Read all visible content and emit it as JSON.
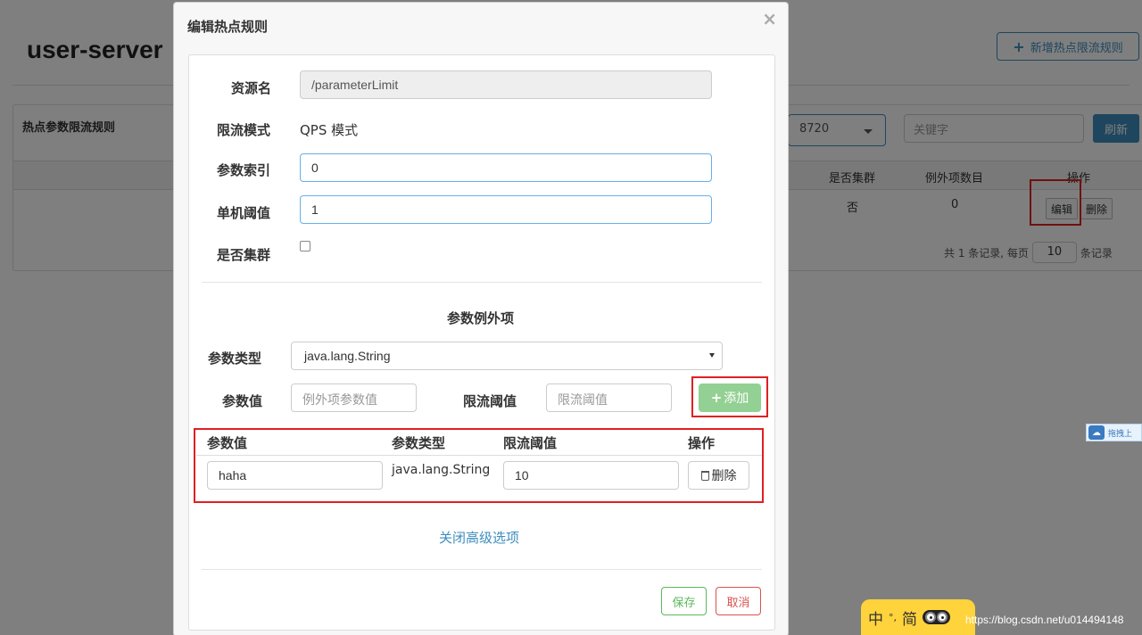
{
  "background": {
    "app_title": "user-server",
    "add_rule_button": "新增热点限流规则",
    "panel_title": "热点参数限流规则",
    "machine_select": "8720",
    "keyword_placeholder": "关键字",
    "refresh_button": "刷新",
    "columns": {
      "cluster": "是否集群",
      "exception_count": "例外项数目",
      "actions": "操作"
    },
    "row": {
      "cluster": "否",
      "exception_count": "0",
      "edit": "编辑",
      "delete": "删除"
    },
    "pager": {
      "prefix": "共 1 条记录, 每页",
      "page_size": "10",
      "suffix": "条记录"
    }
  },
  "modal": {
    "title": "编辑热点规则",
    "close": "×",
    "resource_label": "资源名",
    "resource_value": "/parameterLimit",
    "mode_label": "限流模式",
    "mode_value": "QPS 模式",
    "param_index_label": "参数索引",
    "param_index_value": "0",
    "threshold_label": "单机阈值",
    "threshold_value": "1",
    "cluster_label": "是否集群",
    "cluster_checked": false,
    "exception_section_title": "参数例外项",
    "param_type_label": "参数类型",
    "param_type_value": "java.lang.String",
    "param_value_label": "参数值",
    "param_value_placeholder": "例外项参数值",
    "limit_threshold_label": "限流阈值",
    "limit_threshold_placeholder": "限流阈值",
    "add_button": "添加",
    "table": {
      "headers": [
        "参数值",
        "参数类型",
        "限流阈值",
        "操作"
      ],
      "rows": [
        {
          "value": "haha",
          "type": "java.lang.String",
          "threshold": "10",
          "delete": "删除"
        }
      ]
    },
    "advanced_link": "关闭高级选项",
    "save_button": "保存",
    "cancel_button": "取消"
  },
  "ime": {
    "lang": "中",
    "punct": "°,",
    "mode": "简"
  },
  "watermark": "https://blog.csdn.net/u014494148",
  "side_widget": {
    "label": "拖拽上"
  },
  "colors": {
    "primary": "#3c8dbc",
    "success": "#5cb85c",
    "danger": "#d9534f",
    "highlight": "#e02020"
  }
}
